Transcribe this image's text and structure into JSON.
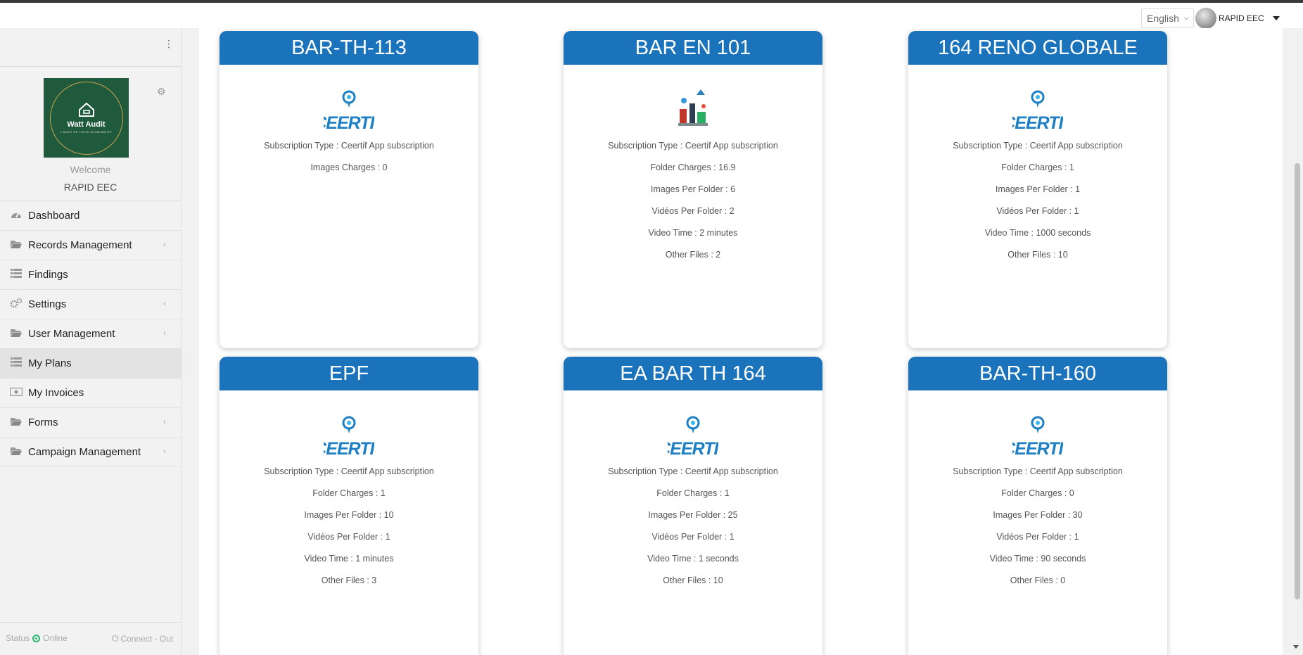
{
  "topbar": {
    "language": "English",
    "username": "RAPID EEC"
  },
  "sidebar": {
    "logo": {
      "name": "Watt Audit",
      "tagline": "L'AUDIT DE TOUTE ECOMOBILITE"
    },
    "welcome": "Welcome",
    "user": "RAPID EEC",
    "items": [
      {
        "label": "Dashboard",
        "icon": "dashboard-icon",
        "chevron": false,
        "active": false
      },
      {
        "label": "Records Management",
        "icon": "folder-icon",
        "chevron": true,
        "active": false
      },
      {
        "label": "Findings",
        "icon": "list-icon",
        "chevron": false,
        "active": false
      },
      {
        "label": "Settings",
        "icon": "gears-icon",
        "chevron": true,
        "active": false
      },
      {
        "label": "User Management",
        "icon": "folder-icon",
        "chevron": true,
        "active": false
      },
      {
        "label": "My Plans",
        "icon": "list-icon",
        "chevron": false,
        "active": true
      },
      {
        "label": "My Invoices",
        "icon": "money-icon",
        "chevron": false,
        "active": false
      },
      {
        "label": "Forms",
        "icon": "folder-icon",
        "chevron": true,
        "active": false
      },
      {
        "label": "Campaign Management",
        "icon": "folder-icon",
        "chevron": true,
        "active": false
      }
    ],
    "status_label": "Status",
    "status_value": "Online",
    "logout": "Connect - Out"
  },
  "plans": [
    {
      "title": "BAR-TH-113",
      "logo": "ceertif-logo",
      "lines": [
        "Subscription Type : Ceertif App subscription",
        "Images Charges : 0"
      ]
    },
    {
      "title": "BAR EN 101",
      "logo": "illustration-logo",
      "lines": [
        "Subscription Type : Ceertif App subscription",
        "Folder Charges : 16.9",
        "Images Per Folder : 6",
        "Vidéos Per Folder : 2",
        "Video Time : 2 minutes",
        "Other Files : 2"
      ]
    },
    {
      "title": "164 RENO GLOBALE",
      "logo": "ceertif-logo",
      "lines": [
        "Subscription Type : Ceertif App subscription",
        "Folder Charges : 1",
        "Images Per Folder : 1",
        "Vidéos Per Folder : 1",
        "Video Time : 1000 seconds",
        "Other Files : 10"
      ]
    },
    {
      "title": "EPF",
      "logo": "ceertif-logo",
      "lines": [
        "Subscription Type : Ceertif App subscription",
        "Folder Charges : 1",
        "Images Per Folder : 10",
        "Vidéos Per Folder : 1",
        "Video Time : 1 minutes",
        "Other Files : 3"
      ]
    },
    {
      "title": "EA BAR TH 164",
      "logo": "ceertif-logo",
      "lines": [
        "Subscription Type : Ceertif App subscription",
        "Folder Charges : 1",
        "Images Per Folder : 25",
        "Vidéos Per Folder : 1",
        "Video Time : 1 seconds",
        "Other Files : 10"
      ]
    },
    {
      "title": "BAR-TH-160",
      "logo": "ceertif-logo",
      "lines": [
        "Subscription Type : Ceertif App subscription",
        "Folder Charges : 0",
        "Images Per Folder : 30",
        "Vidéos Per Folder : 1",
        "Video Time : 90 seconds",
        "Other Files : 0"
      ]
    }
  ],
  "colors": {
    "header_blue": "#1a73bb",
    "status_green": "#2bb673",
    "logo_green": "#1f5a3d"
  }
}
